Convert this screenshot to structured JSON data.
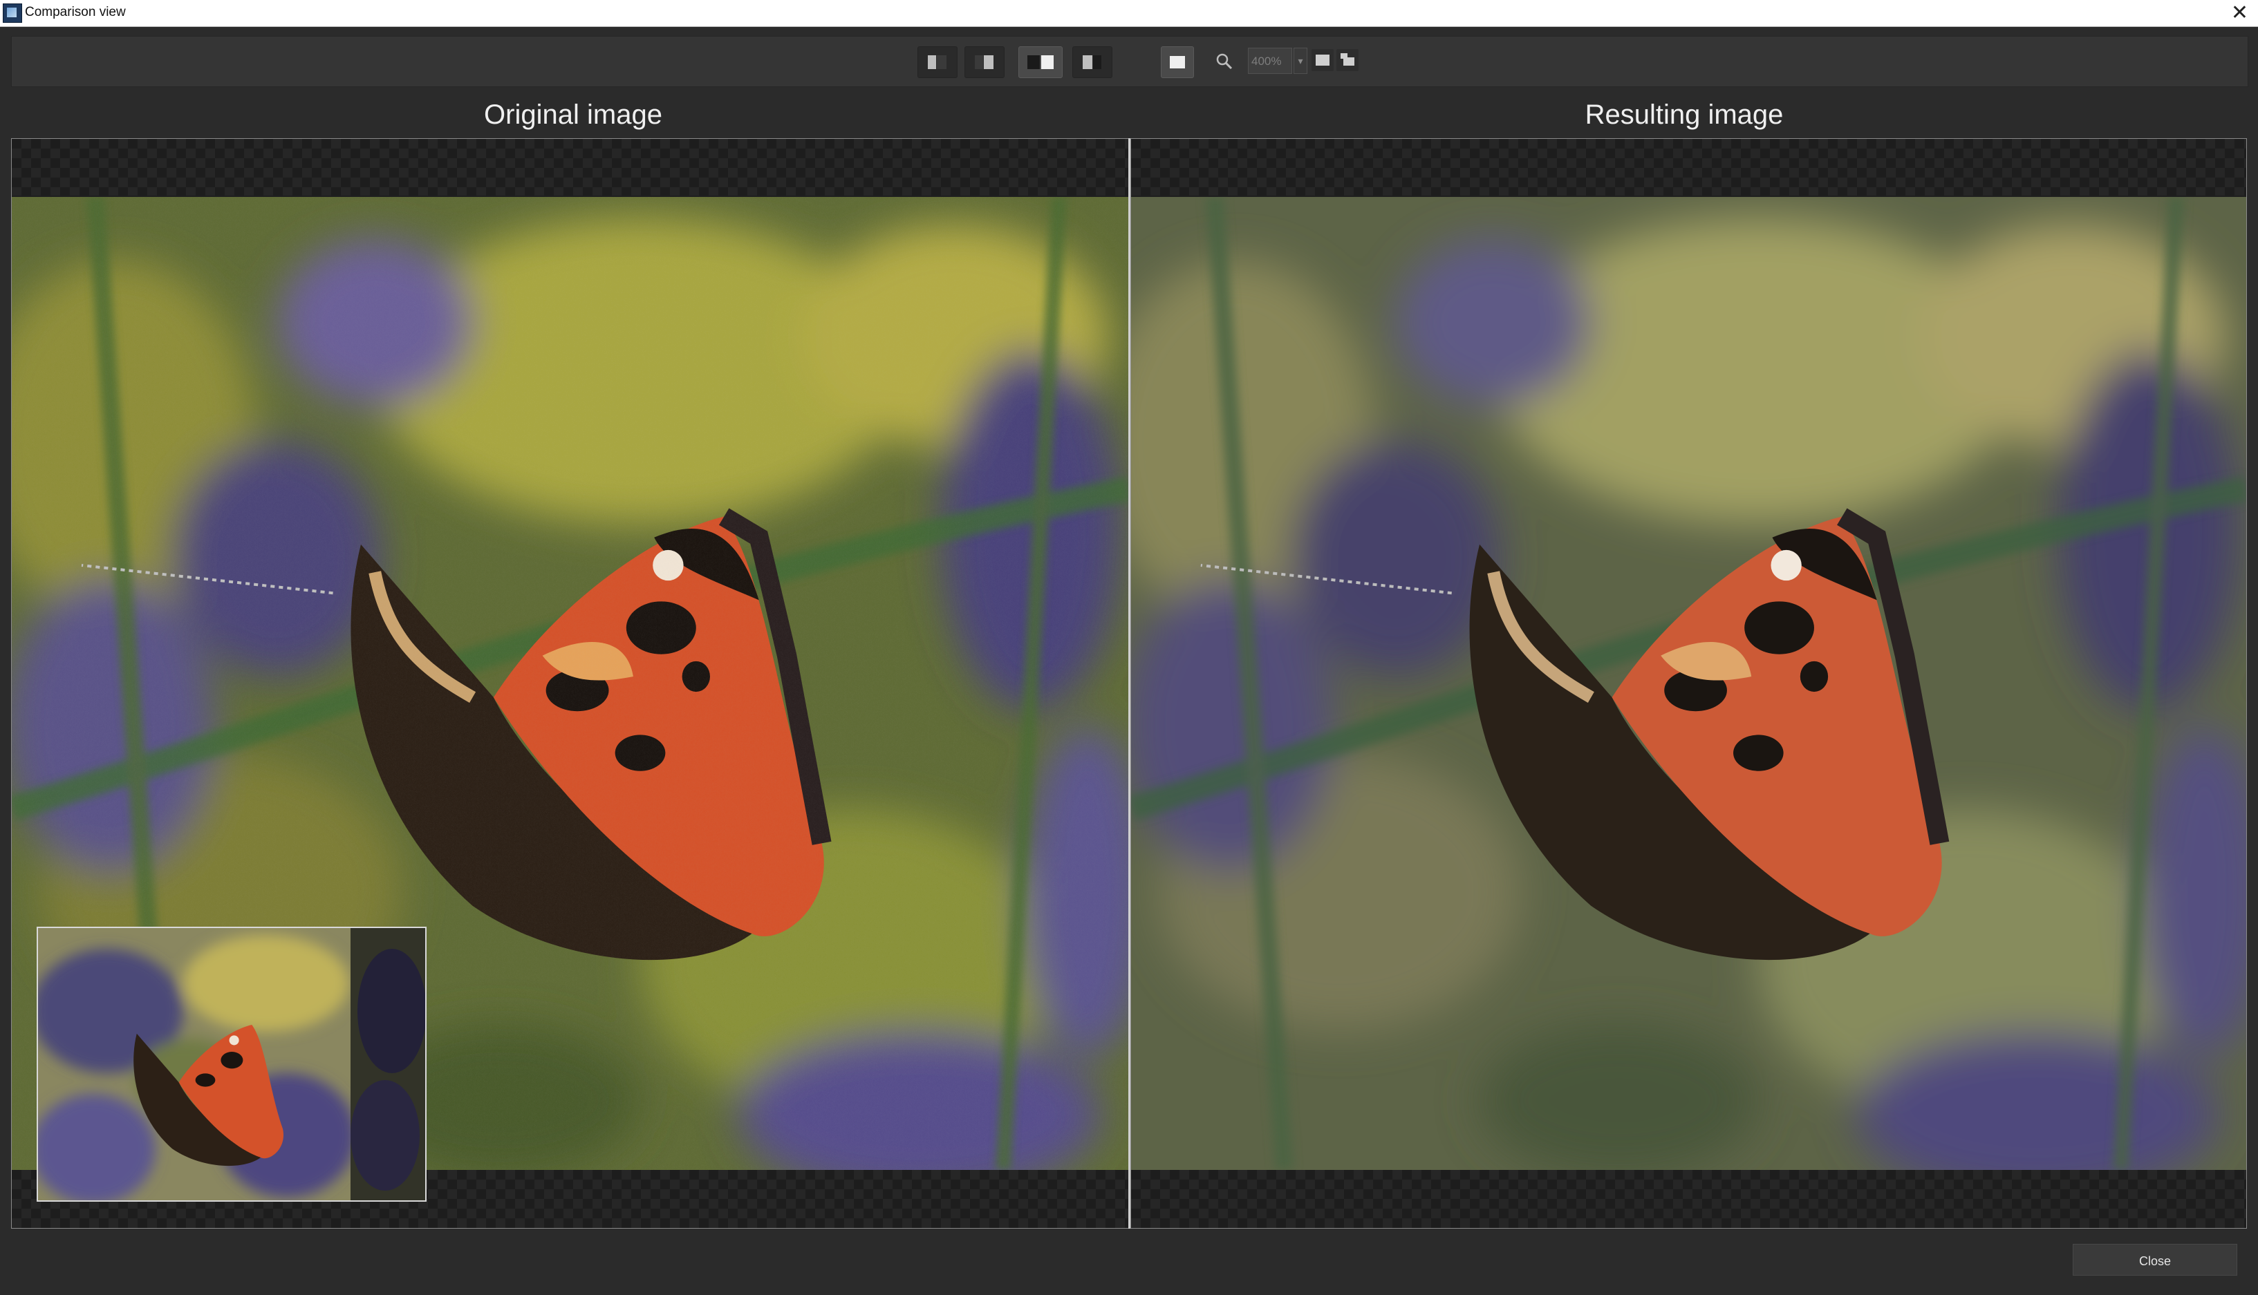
{
  "window": {
    "title": "Comparison view",
    "close_icon": "close-icon"
  },
  "toolbar": {
    "view_modes": [
      {
        "name": "single-left-view",
        "icon": "split-left-icon",
        "active": false
      },
      {
        "name": "single-right-view",
        "icon": "split-right-icon",
        "active": false
      },
      {
        "name": "side-by-side-view",
        "icon": "side-by-side-icon",
        "active": true
      },
      {
        "name": "split-view",
        "icon": "split-screen-icon",
        "active": false
      }
    ],
    "navigator_toggle_active": true,
    "zoom_icon": "magnifier-icon",
    "zoom_value": "400%",
    "fit_buttons": [
      "fit-to-window-icon",
      "actual-size-icon"
    ]
  },
  "panes": {
    "left_title": "Original image",
    "right_title": "Resulting image"
  },
  "footer": {
    "close_label": "Close"
  },
  "colors": {
    "background": "#2b2b2b",
    "toolbar": "#353535",
    "active_button": "#4a4a4a"
  }
}
